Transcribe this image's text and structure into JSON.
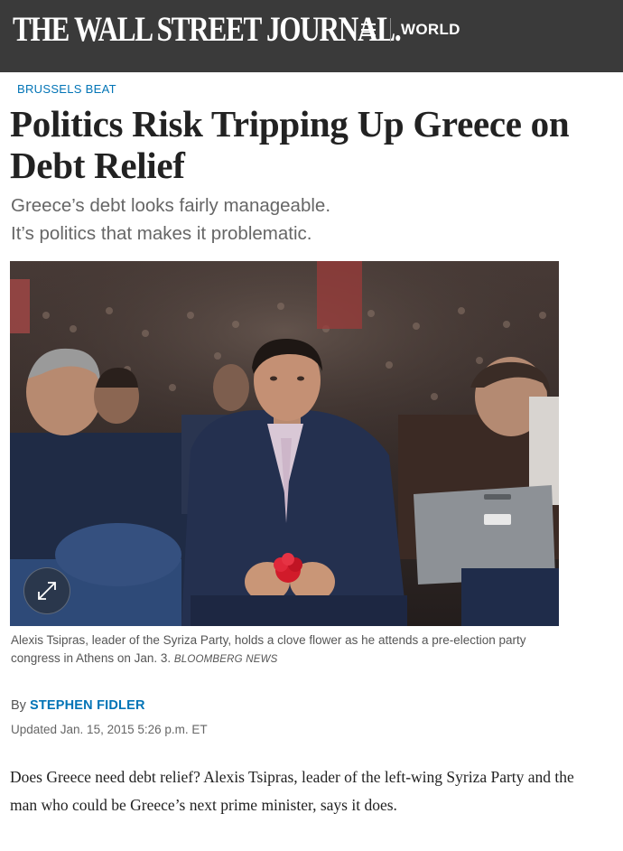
{
  "header": {
    "masthead": "THE WALL STREET JOURNAL.",
    "section": "WORLD",
    "menu_icon": "hamburger-menu-icon",
    "background_color": "#3a3a3a"
  },
  "article": {
    "kicker": "BRUSSELS BEAT",
    "headline": "Politics Risk Tripping Up Greece on Debt Relief",
    "dek_line1": "Greece’s debt looks fairly manageable.",
    "dek_line2": "It’s politics that makes it problematic.",
    "image": {
      "description_icon": "expand-icon",
      "caption": "Alexis Tsipras, leader of the Syriza Party, holds a clove flower as he attends a pre-election party congress in Athens on Jan. 3.",
      "credit": "BLOOMBERG NEWS"
    },
    "byline_prefix": "By",
    "author": "STEPHEN FIDLER",
    "timestamp": "Updated Jan. 15, 2015 5:26 p.m. ET",
    "body": "Does Greece need debt relief? Alexis Tsipras, leader of the left-wing Syriza Party and the man who could be Greece’s next prime minister, says it does."
  },
  "colors": {
    "accent_blue": "#0274b6",
    "headline": "#222222",
    "dek": "#666666"
  }
}
